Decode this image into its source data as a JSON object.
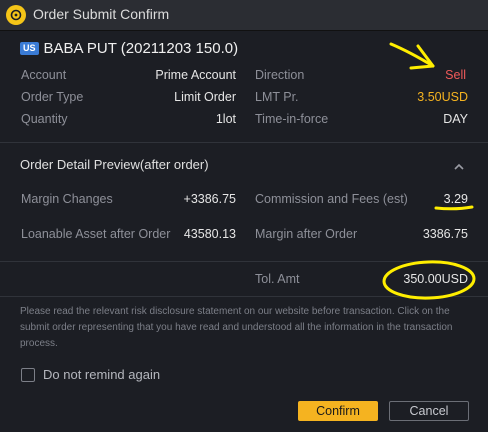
{
  "window": {
    "title": "Order Submit Confirm"
  },
  "order": {
    "market_badge": "US",
    "symbol": "BABA PUT (20211203 150.0)"
  },
  "details": {
    "account_label": "Account",
    "account_value": "Prime Account",
    "direction_label": "Direction",
    "direction_value": "Sell",
    "order_type_label": "Order Type",
    "order_type_value": "Limit Order",
    "lmt_label": "LMT Pr.",
    "lmt_value": "3.50USD",
    "quantity_label": "Quantity",
    "quantity_value": "1lot",
    "tif_label": "Time-in-force",
    "tif_value": "DAY"
  },
  "preview": {
    "title": "Order Detail Preview(after order)",
    "margin_changes_label": "Margin Changes",
    "margin_changes_value": "+3386.75",
    "commission_label": "Commission and Fees (est)",
    "commission_value": "3.29",
    "loanable_label": "Loanable Asset after Order",
    "loanable_value": "43580.13",
    "margin_after_label": "Margin after Order",
    "margin_after_value": "3386.75",
    "total_label": "Tol. Amt",
    "total_value": "350.00USD"
  },
  "disclaimer": "Please read the relevant risk disclosure statement on our website before transaction. Click on the submit order representing that you have read and understood all the information in the transaction process.",
  "checkbox": {
    "label": "Do not remind again",
    "checked": false
  },
  "buttons": {
    "confirm": "Confirm",
    "cancel": "Cancel"
  },
  "icons": {
    "app": "app-logo-icon",
    "collapse": "chevron-up-icon"
  },
  "colors": {
    "accent": "#f5b320",
    "sell": "#f05a5a",
    "annotation": "#ffee00"
  }
}
